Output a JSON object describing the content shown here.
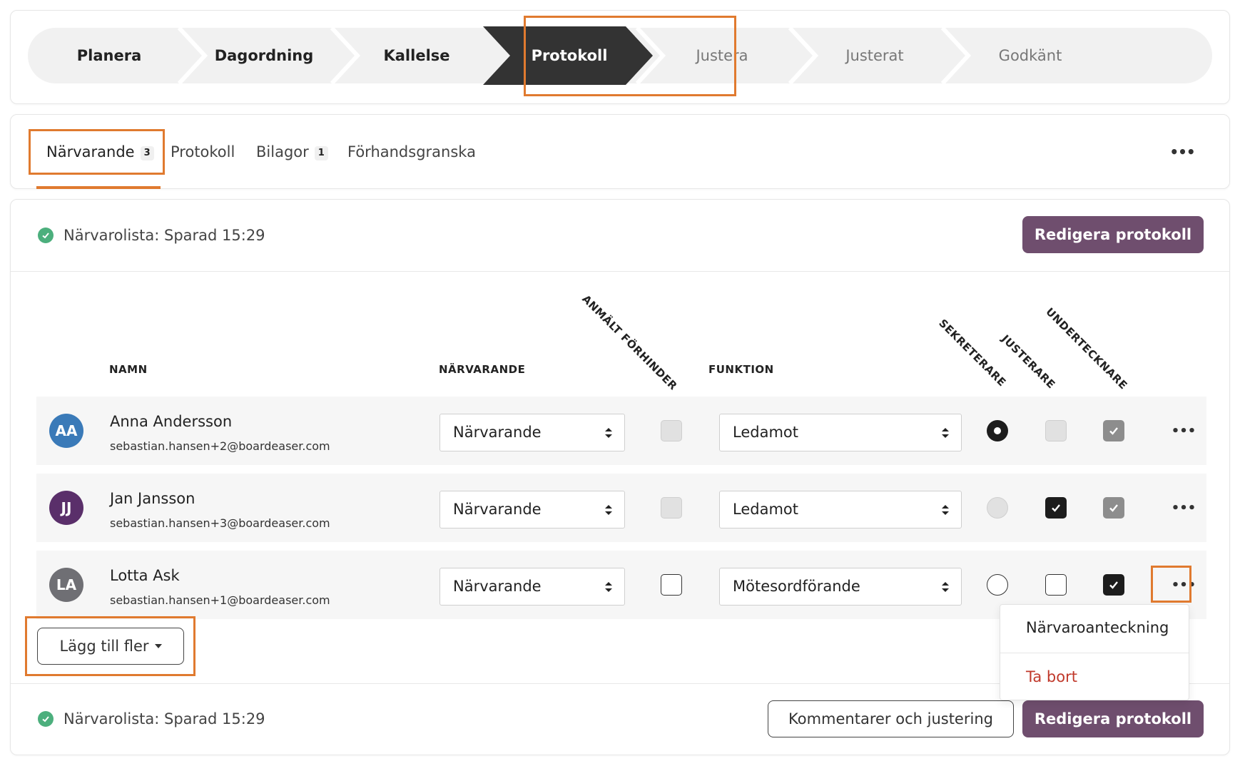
{
  "stepper": {
    "steps": [
      {
        "label": "Planera",
        "state": "done"
      },
      {
        "label": "Dagordning",
        "state": "done"
      },
      {
        "label": "Kallelse",
        "state": "done"
      },
      {
        "label": "Protokoll",
        "state": "active"
      },
      {
        "label": "Justera",
        "state": "future"
      },
      {
        "label": "Justerat",
        "state": "future"
      },
      {
        "label": "Godkänt",
        "state": "future"
      }
    ]
  },
  "tabs": [
    {
      "label": "Närvarande",
      "badge": "3",
      "active": true
    },
    {
      "label": "Protokoll",
      "badge": ""
    },
    {
      "label": "Bilagor",
      "badge": "1"
    },
    {
      "label": "Förhandsgranska",
      "badge": ""
    }
  ],
  "status": {
    "top": "Närvarolista: Sparad 15:29",
    "bottom": "Närvarolista: Sparad 15:29"
  },
  "buttons": {
    "edit_protocol": "Redigera protokoll",
    "comments": "Kommentarer och justering",
    "add_more": "Lägg till fler"
  },
  "table": {
    "headers": {
      "name": "NAMN",
      "attendance": "NÄRVARANDE",
      "absence_notice": "ANMÄLT FÖRHINDER",
      "function": "FUNKTION",
      "secretary": "SEKRETERARE",
      "adjuster": "JUSTERARE",
      "signer": "UNDERTECKNARE"
    },
    "rows": [
      {
        "initials": "AA",
        "avatar_color": "#3a7ab8",
        "name": "Anna Andersson",
        "email": "sebastian.hansen+2@boardeaser.com",
        "attendance": "Närvarande",
        "function": "Ledamot",
        "absence_notice": "disabled",
        "secretary": "selected",
        "adjuster": "disabled",
        "signer": "grey-checked"
      },
      {
        "initials": "JJ",
        "avatar_color": "#5a2f6a",
        "name": "Jan Jansson",
        "email": "sebastian.hansen+3@boardeaser.com",
        "attendance": "Närvarande",
        "function": "Ledamot",
        "absence_notice": "disabled",
        "secretary": "disabled",
        "adjuster": "checked",
        "signer": "grey-checked"
      },
      {
        "initials": "LA",
        "avatar_color": "#6f6f74",
        "name": "Lotta Ask",
        "email": "sebastian.hansen+1@boardeaser.com",
        "attendance": "Närvarande",
        "function": "Mötesordförande",
        "absence_notice": "empty",
        "secretary": "empty",
        "adjuster": "empty",
        "signer": "checked"
      }
    ]
  },
  "row_menu": {
    "items": [
      {
        "label": "Närvaroanteckning",
        "color": "#222222"
      },
      {
        "label": "Ta bort",
        "color": "#c0392b"
      }
    ]
  },
  "colors": {
    "accent_highlight": "#e07a2f",
    "primary_button": "#6f4e6e",
    "active_step": "#333333",
    "success": "#4caf7d"
  }
}
